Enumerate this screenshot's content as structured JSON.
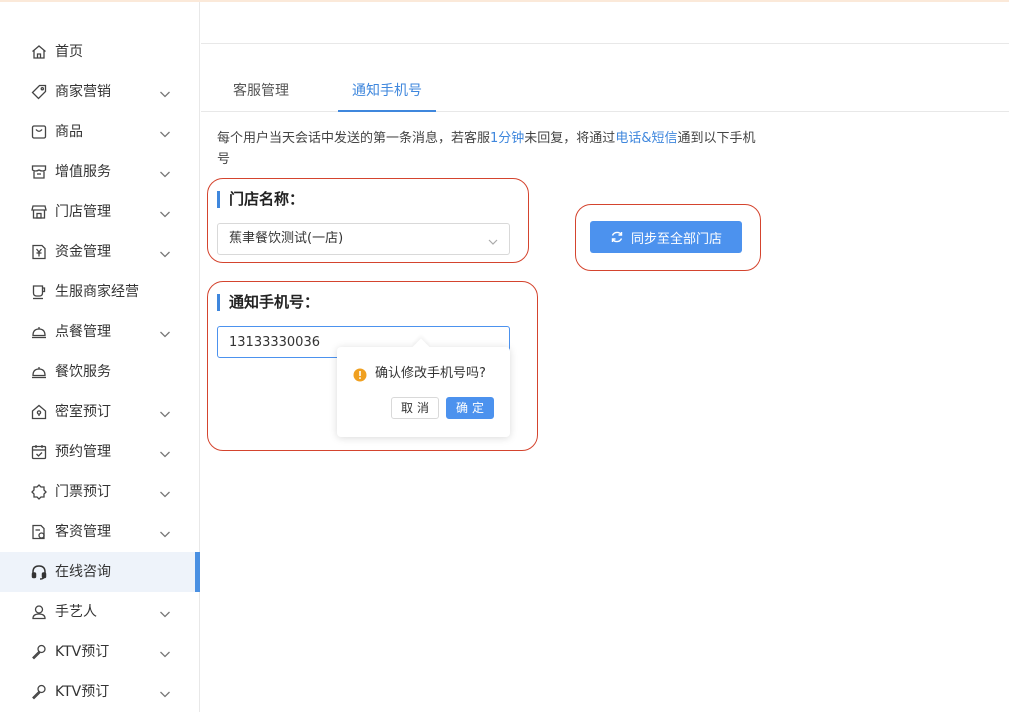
{
  "sidebar": {
    "items": [
      {
        "label": "首页",
        "icon": "home-icon",
        "expandable": false
      },
      {
        "label": "商家营销",
        "icon": "tag-icon",
        "expandable": true
      },
      {
        "label": "商品",
        "icon": "bag-icon",
        "expandable": true
      },
      {
        "label": "增值服务",
        "icon": "store-icon",
        "expandable": true
      },
      {
        "label": "门店管理",
        "icon": "shop-icon",
        "expandable": true
      },
      {
        "label": "资金管理",
        "icon": "yen-icon",
        "expandable": true
      },
      {
        "label": "生服商家经营",
        "icon": "cup-icon",
        "expandable": false
      },
      {
        "label": "点餐管理",
        "icon": "cloche-icon",
        "expandable": true
      },
      {
        "label": "餐饮服务",
        "icon": "cloche-icon",
        "expandable": false
      },
      {
        "label": "密室预订",
        "icon": "house-lock-icon",
        "expandable": true
      },
      {
        "label": "预约管理",
        "icon": "calendar-icon",
        "expandable": true
      },
      {
        "label": "门票预订",
        "icon": "ticket-icon",
        "expandable": true
      },
      {
        "label": "客资管理",
        "icon": "document-icon",
        "expandable": true
      },
      {
        "label": "在线咨询",
        "icon": "headset-icon",
        "expandable": false,
        "active": true
      },
      {
        "label": "手艺人",
        "icon": "user-icon",
        "expandable": true
      },
      {
        "label": "KTV预订",
        "icon": "microphone-icon",
        "expandable": true
      },
      {
        "label": "KTV预订",
        "icon": "microphone-icon",
        "expandable": true
      }
    ]
  },
  "tabs": [
    {
      "label": "客服管理",
      "active": false
    },
    {
      "label": "通知手机号",
      "active": true
    }
  ],
  "description": {
    "part1": "每个用户当天会话中发送的第一条消息，若客服",
    "hl1": "1分钟",
    "part2": "未回复，将通过",
    "hl2": "电话&短信",
    "part3": "通到以下手机号"
  },
  "store": {
    "title": "门店名称：",
    "selected": "蕉聿餐饮测试(一店)"
  },
  "sync_button": {
    "label": "同步至全部门店"
  },
  "phone": {
    "title": "通知手机号：",
    "value": "13133330036"
  },
  "popconfirm": {
    "message": "确认修改手机号吗?",
    "cancel": "取消",
    "ok": "确定"
  },
  "colors": {
    "accent": "#4c92ee",
    "highlight_text": "#3f87dd",
    "annotation": "#d4442e",
    "warning": "#f0a020"
  }
}
